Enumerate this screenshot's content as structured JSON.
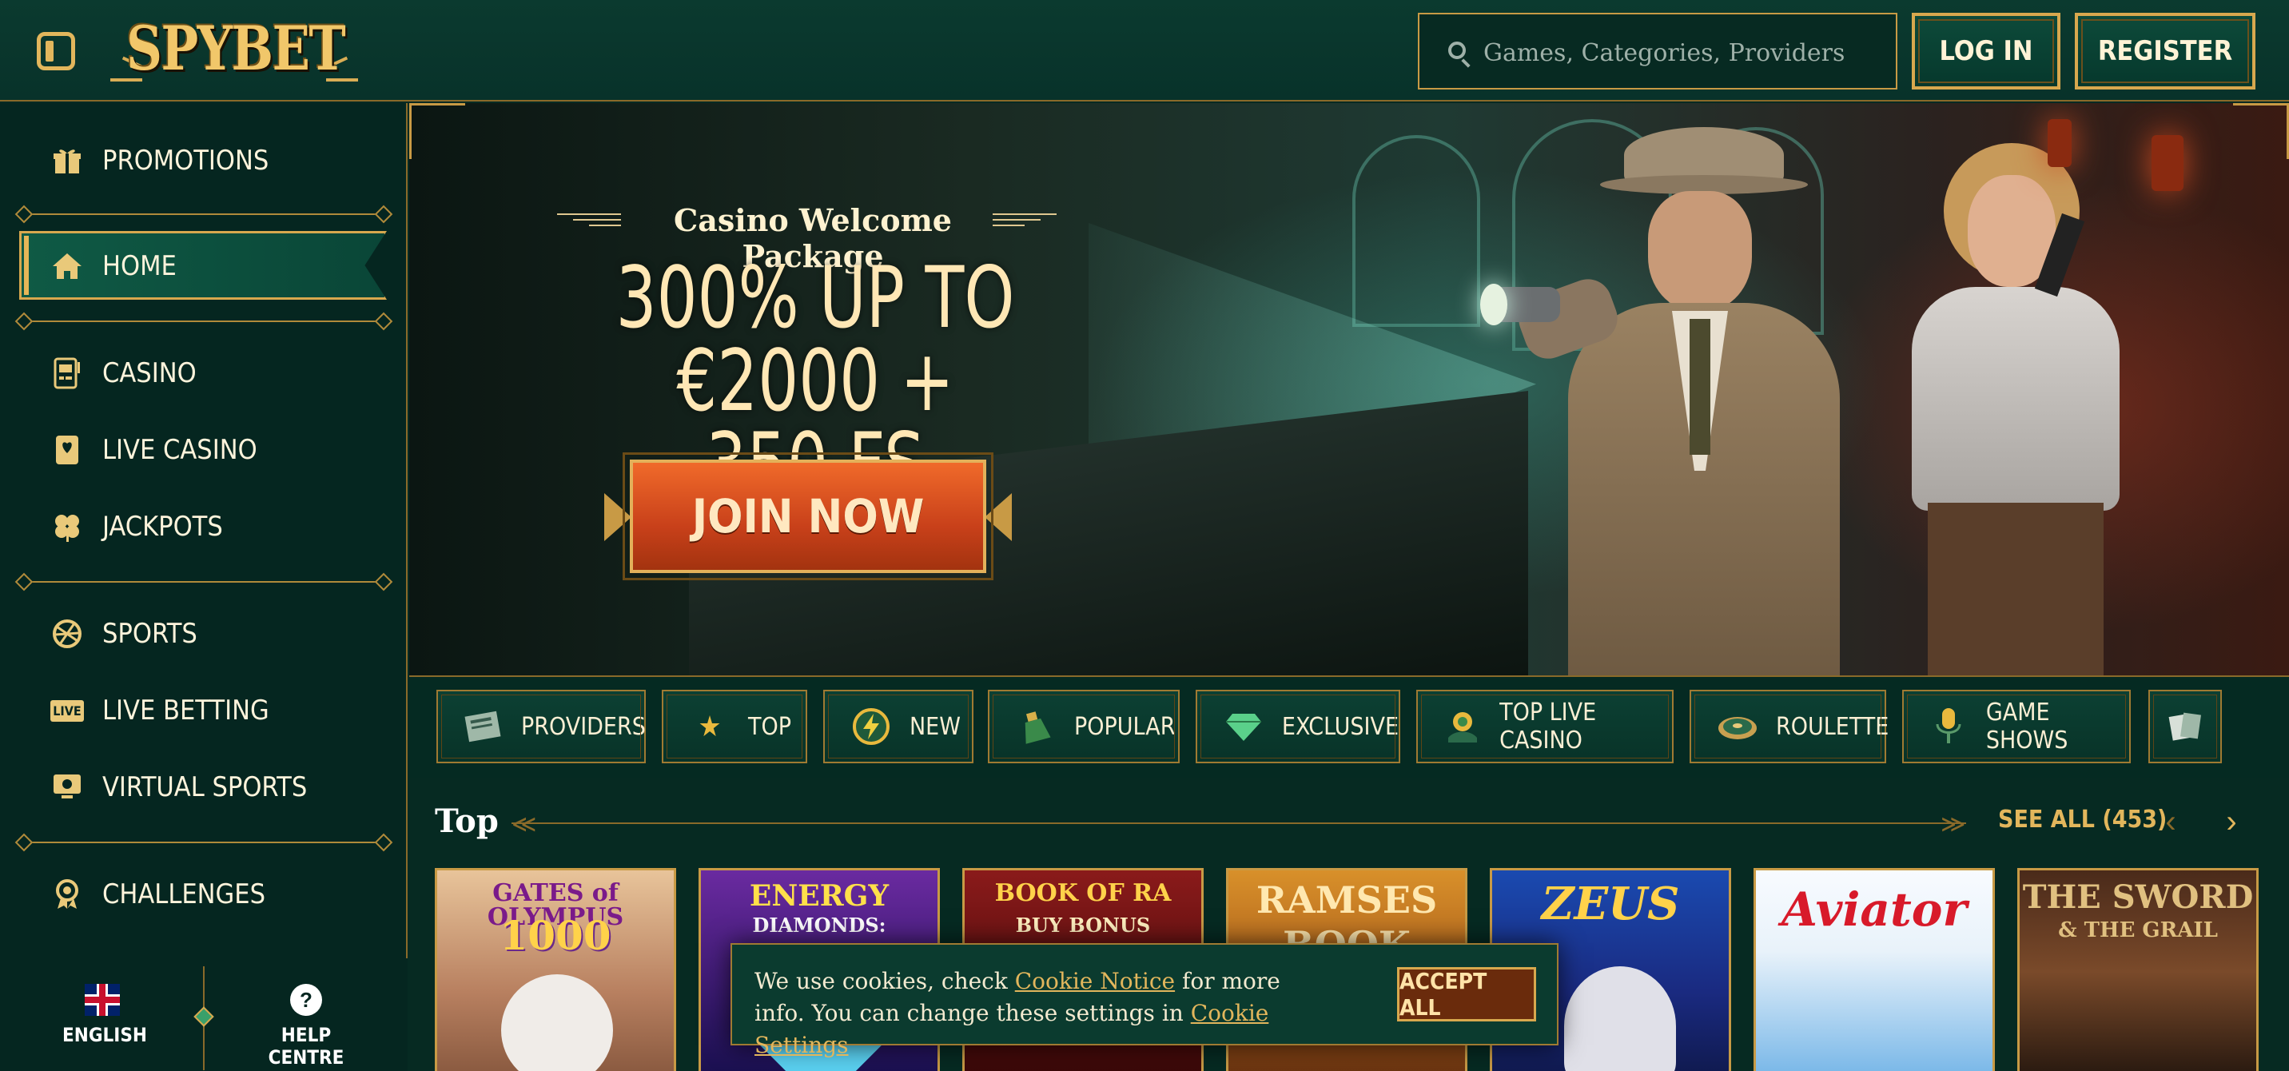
{
  "header": {
    "logo_text": "SPYBET",
    "search_placeholder": "Games, Categories, Providers",
    "login_label": "LOG IN",
    "register_label": "REGISTER"
  },
  "sidebar": {
    "items": [
      {
        "label": "PROMOTIONS",
        "icon": "gift-icon"
      },
      {
        "label": "HOME",
        "icon": "home-icon"
      },
      {
        "label": "CASINO",
        "icon": "slot-machine-icon"
      },
      {
        "label": "LIVE CASINO",
        "icon": "playing-card-icon"
      },
      {
        "label": "JACKPOTS",
        "icon": "clover-icon"
      },
      {
        "label": "SPORTS",
        "icon": "ball-icon"
      },
      {
        "label": "LIVE BETTING",
        "icon": "live-icon"
      },
      {
        "label": "VIRTUAL SPORTS",
        "icon": "virtual-screen-icon"
      },
      {
        "label": "CHALLENGES",
        "icon": "badge-icon"
      }
    ],
    "live_badge": "LIVE",
    "footer": {
      "language_label": "ENGLISH",
      "help_label": "HELP CENTRE",
      "help_glyph": "?"
    }
  },
  "hero": {
    "subtitle": "Casino Welcome Package",
    "headline_line1": "300% UP TO €2000 +",
    "headline_line2": "350 FS",
    "cta_label": "JOIN NOW"
  },
  "categories": [
    {
      "label": "PROVIDERS",
      "icon": "newspaper-icon"
    },
    {
      "label": "TOP",
      "icon": "star-icon"
    },
    {
      "label": "NEW",
      "icon": "lightning-icon"
    },
    {
      "label": "POPULAR",
      "icon": "money-bag-icon"
    },
    {
      "label": "EXCLUSIVE",
      "icon": "diamond-icon"
    },
    {
      "label": "TOP LIVE CASINO",
      "icon": "chip-hand-icon"
    },
    {
      "label": "ROULETTE",
      "icon": "roulette-icon"
    },
    {
      "label": "GAME SHOWS",
      "icon": "microphone-icon"
    }
  ],
  "top_section": {
    "title": "Top",
    "see_all_label": "SEE ALL (453)",
    "games": [
      {
        "title": "GATES of OLYMPUS",
        "subtitle": "1000"
      },
      {
        "title": "ENERGY",
        "subtitle": "DIAMONDS:"
      },
      {
        "title": "BOOK OF RA",
        "subtitle": "BUY BONUS"
      },
      {
        "title": "RAMSES",
        "subtitle": "BOOK"
      },
      {
        "title": "ZEUS",
        "subtitle": ""
      },
      {
        "title": "Aviator",
        "subtitle": ""
      },
      {
        "title": "THE SWORD",
        "subtitle": "& THE GRAIL"
      }
    ]
  },
  "cookie": {
    "text_before": "We use cookies, check ",
    "link1": "Cookie Notice",
    "text_middle": " for more info. You can change these settings in ",
    "link2": "Cookie Settings",
    "accept_label": "ACCEPT ALL"
  },
  "colors": {
    "accent_gold": "#e2b65c",
    "background_green": "#062a22",
    "cta_orange": "#d9491c"
  }
}
